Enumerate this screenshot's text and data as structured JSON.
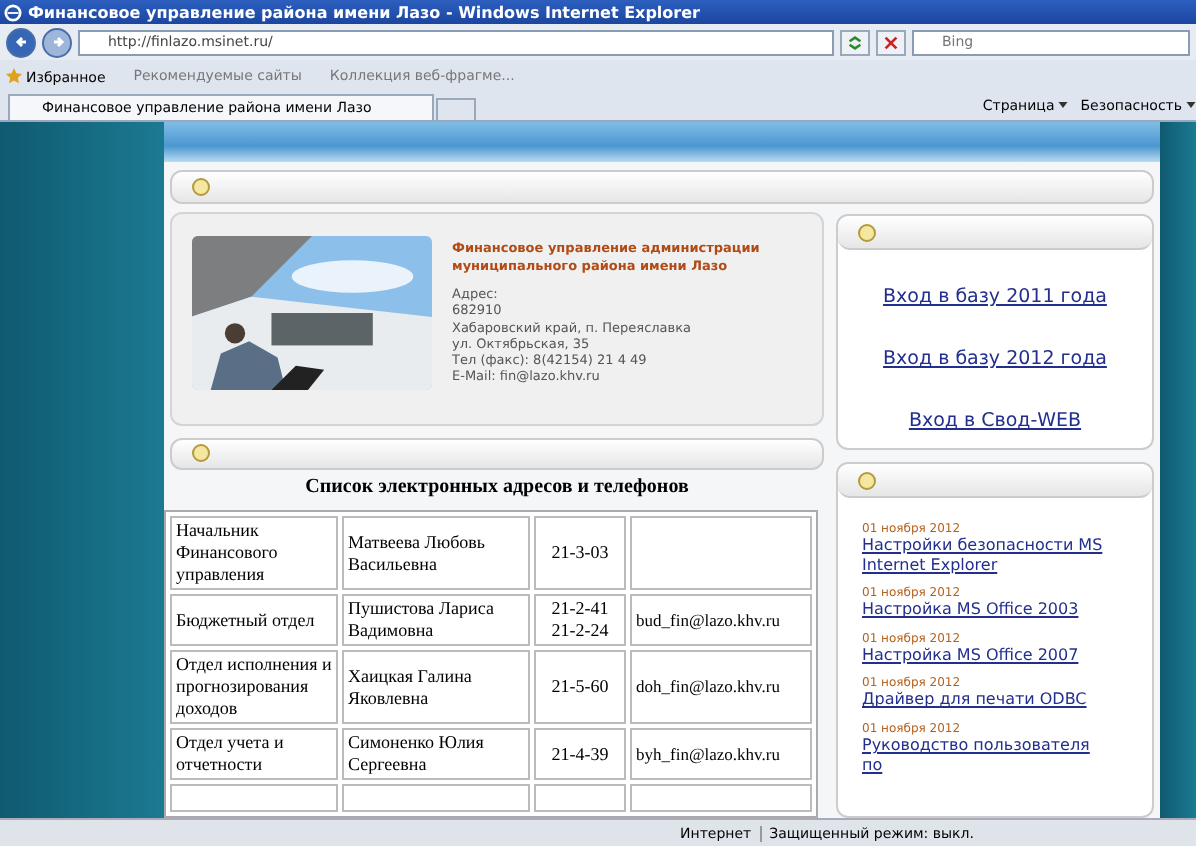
{
  "window": {
    "title": "Финансовое управление района имени Лазо - Windows Internet Explorer"
  },
  "address_bar": {
    "url": "http://finlazo.msinet.ru/",
    "search_placeholder": "Bing"
  },
  "favorites_bar": {
    "favorites": "Избранное",
    "links": [
      "Рекомендуемые сайты",
      "Коллекция веб-фрагме..."
    ]
  },
  "tab": {
    "title": "Финансовое управление района имени Лазо"
  },
  "command_bar": {
    "items": [
      "Страница",
      "Безопасность"
    ]
  },
  "organization": {
    "name": "Финансовое управление администрации муниципального района имени Лазо",
    "address_lines": [
      "Адрес:",
      "682910",
      "Хабаровский край, п. Переяславка",
      "ул. Октябрьская, 35",
      "Тел (факс): 8(42154) 21 4 49",
      "E-Mail: fin@lazo.khv.ru"
    ]
  },
  "contacts": {
    "title": "Список электронных адресов и телефонов",
    "rows": [
      {
        "department": "Начальник Финансового управления",
        "person": "Матвеева Любовь Васильевна",
        "phones": [
          "21-3-03"
        ],
        "email": ""
      },
      {
        "department": "Бюджетный отдел",
        "person": "Пушистова Лариса Вадимовна",
        "phones": [
          "21-2-41",
          "21-2-24"
        ],
        "email": "bud_fin@lazo.khv.ru"
      },
      {
        "department": "Отдел исполнения и прогнозирования доходов",
        "person": "Хаицкая Галина Яковлевна",
        "phones": [
          "21-5-60"
        ],
        "email": "doh_fin@lazo.khv.ru"
      },
      {
        "department": "Отдел учета и отчетности",
        "person": "Симоненко Юлия Сергеевна",
        "phones": [
          "21-4-39"
        ],
        "email": "byh_fin@lazo.khv.ru"
      }
    ]
  },
  "login_links": [
    "Вход в базу 2011 года",
    "Вход в базу 2012 года",
    "Вход в Свод-WEB"
  ],
  "news": [
    {
      "date": "01 ноября 2012",
      "title": "Настройки безопасности MS Internet Explorer"
    },
    {
      "date": "01 ноября 2012",
      "title": "Настройка MS Office 2003"
    },
    {
      "date": "01 ноября 2012",
      "title": "Настройка MS Office 2007"
    },
    {
      "date": "01 ноября 2012",
      "title": "Драйвер для печати ODBC"
    },
    {
      "date": "01 ноября 2012",
      "title": "Руководство пользователя по"
    }
  ],
  "status_bar": {
    "zone": "Интернет",
    "protected_mode": "Защищенный режим: выкл."
  }
}
